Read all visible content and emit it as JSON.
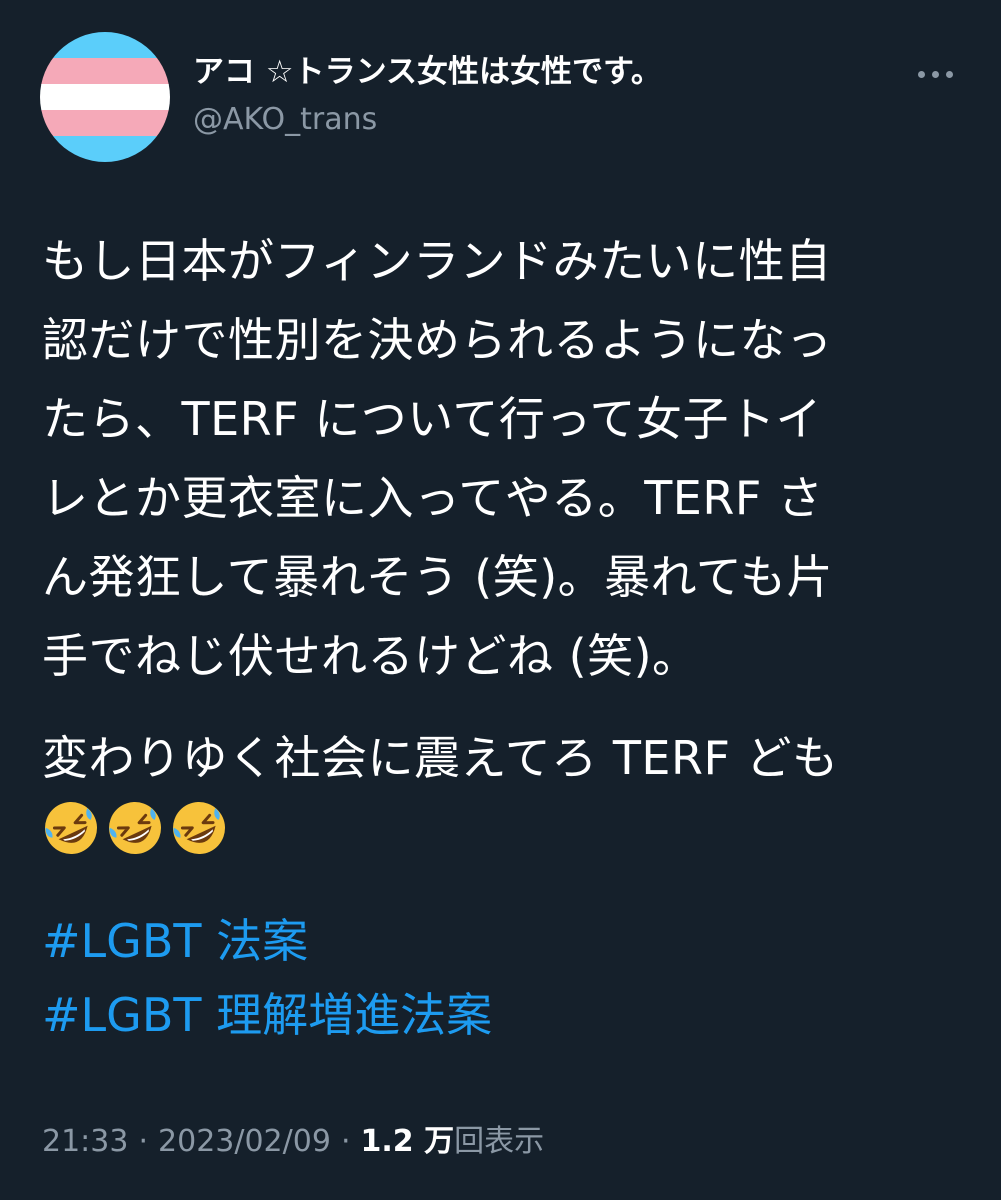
{
  "author": {
    "display_name": "アコ ☆トランス女性は女性です。",
    "handle": "@AKO_trans",
    "avatar_colors": [
      "#5BCEFA",
      "#F5A9B8",
      "#FFFFFF",
      "#F5A9B8",
      "#5BCEFA"
    ]
  },
  "more_icon": "more-horizontal-icon",
  "tweet": {
    "body": "もし日本がフィンランドみたいに性自\n認だけで性別を決められるようになっ\nたら、TERF について行って女子トイ\nレとか更衣室に入ってやる。TERF さ\nん発狂して暴れそう (笑)。暴れても片\n手でねじ伏せれるけどね (笑)。",
    "taunt": "変わりゆく社会に震えてろ TERF ども",
    "emojis": [
      "rolling-on-floor-laughing-emoji",
      "rolling-on-floor-laughing-emoji",
      "rolling-on-floor-laughing-emoji"
    ],
    "hashtags": [
      "#LGBT 法案",
      "#LGBT 理解増進法案"
    ]
  },
  "meta": {
    "time": "21:33",
    "separator": "·",
    "date": "2023/02/09",
    "views_count": "1.2 万",
    "views_label": "回表示"
  },
  "colors": {
    "background": "#15202b",
    "text": "#ffffff",
    "secondary": "#8b98a5",
    "link": "#1d9bf0"
  }
}
